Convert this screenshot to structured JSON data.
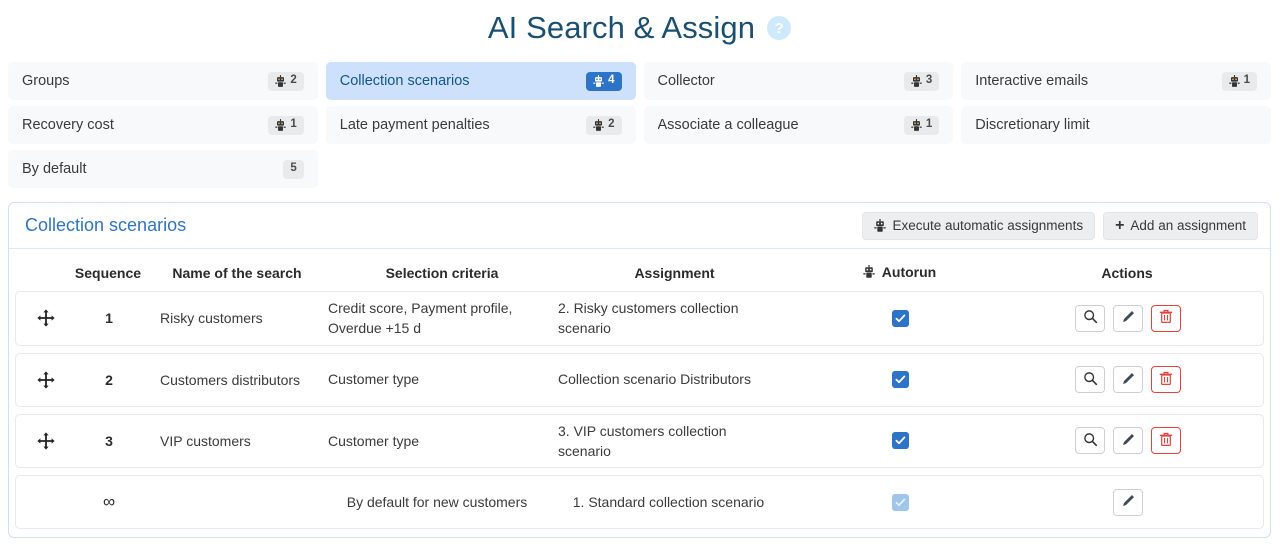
{
  "header": {
    "title": "AI Search & Assign",
    "help_icon": "help-circle-icon",
    "help_label": "?"
  },
  "tabs": [
    {
      "label": "Groups",
      "count": "2",
      "robot": true,
      "active": false
    },
    {
      "label": "Collection scenarios",
      "count": "4",
      "robot": true,
      "active": true
    },
    {
      "label": "Collector",
      "count": "3",
      "robot": true,
      "active": false
    },
    {
      "label": "Interactive emails",
      "count": "1",
      "robot": true,
      "active": false
    },
    {
      "label": "Recovery cost",
      "count": "1",
      "robot": true,
      "active": false
    },
    {
      "label": "Late payment penalties",
      "count": "2",
      "robot": true,
      "active": false
    },
    {
      "label": "Associate a colleague",
      "count": "1",
      "robot": true,
      "active": false
    },
    {
      "label": "Discretionary limit",
      "count": "",
      "robot": false,
      "active": false
    },
    {
      "label": "By default",
      "count": "5",
      "robot": false,
      "active": false
    }
  ],
  "panel": {
    "title": "Collection scenarios",
    "execute_button": "Execute automatic assignments",
    "execute_icon": "robot-icon",
    "add_button": "Add an assignment",
    "add_icon": "plus-icon"
  },
  "table": {
    "columns": {
      "drag": "",
      "sequence": "Sequence",
      "name": "Name of the search",
      "criteria": "Selection criteria",
      "assignment": "Assignment",
      "autorun": "Autorun",
      "autorun_icon": "robot-icon",
      "actions": "Actions"
    },
    "rows": [
      {
        "draggable": true,
        "sequence": "1",
        "name": "Risky customers",
        "criteria": "Credit score, Payment profile, Overdue +15 d",
        "assignment": "2. Risky customers collection scenario",
        "autorun": true,
        "autorun_disabled": false,
        "actions": [
          "search-icon",
          "edit-icon",
          "delete-icon"
        ]
      },
      {
        "draggable": true,
        "sequence": "2",
        "name": "Customers distributors",
        "criteria": "Customer type",
        "assignment": "Collection scenario Distributors",
        "autorun": true,
        "autorun_disabled": false,
        "actions": [
          "search-icon",
          "edit-icon",
          "delete-icon"
        ]
      },
      {
        "draggable": true,
        "sequence": "3",
        "name": "VIP customers",
        "criteria": "Customer type",
        "assignment": "3. VIP customers collection scenario",
        "autorun": true,
        "autorun_disabled": false,
        "actions": [
          "search-icon",
          "edit-icon",
          "delete-icon"
        ]
      },
      {
        "draggable": false,
        "sequence": "∞",
        "name": "",
        "criteria": "By default for new customers",
        "assignment": "1. Standard collection scenario",
        "autorun": true,
        "autorun_disabled": true,
        "actions": [
          "edit-icon"
        ]
      }
    ]
  },
  "colors": {
    "title": "#1b4f72",
    "accent": "#2d74c8",
    "active_tab_bg": "#cde1fd",
    "tab_bg": "#f7f9fb",
    "panel_border": "#cfe0f5",
    "danger": "#e8413c",
    "help_bg": "#cde9fa"
  }
}
